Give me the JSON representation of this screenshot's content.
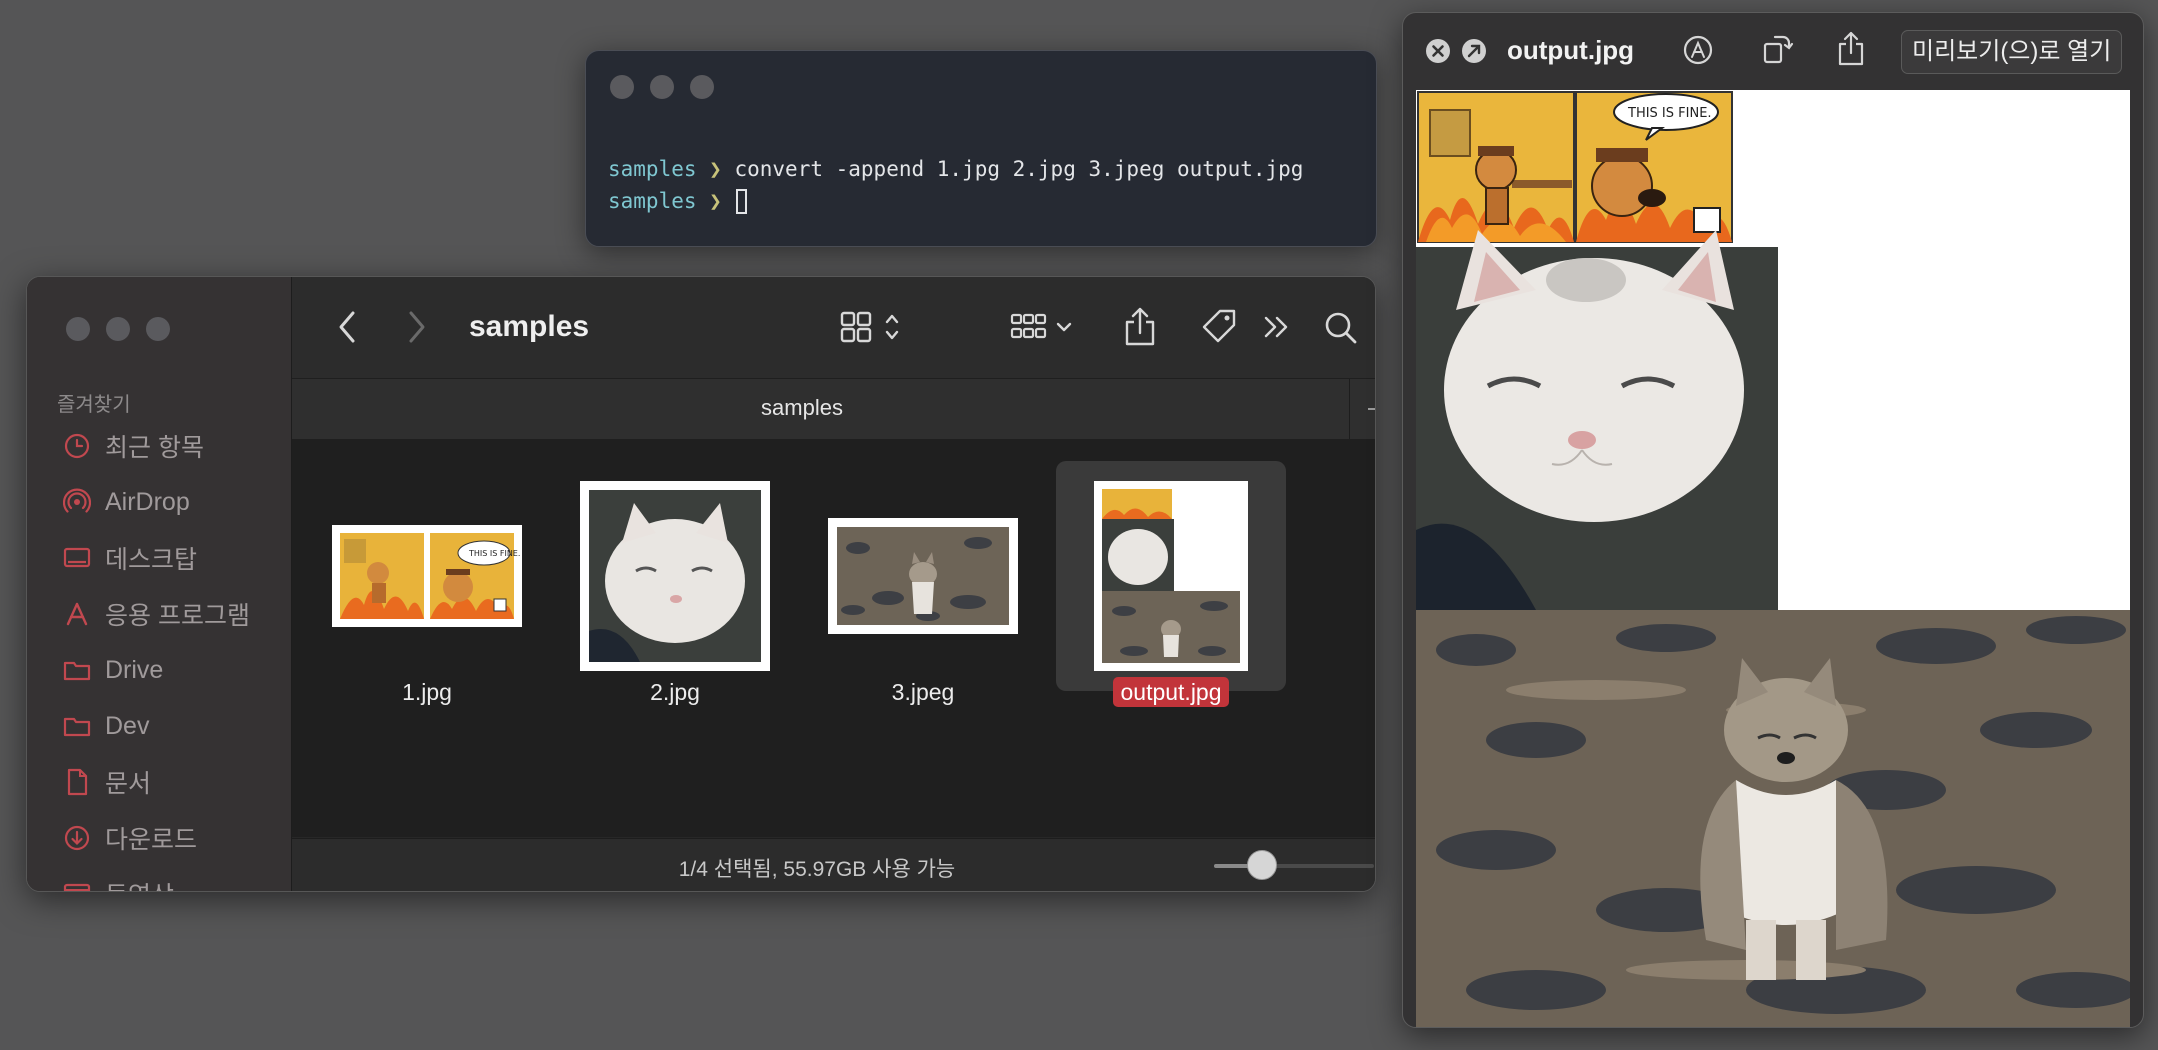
{
  "terminal": {
    "lines": [
      {
        "dir": "samples",
        "arrow": "❯",
        "command": "convert -append 1.jpg 2.jpg 3.jpeg output.jpg"
      },
      {
        "dir": "samples",
        "arrow": "❯",
        "command": ""
      }
    ]
  },
  "finder": {
    "title": "samples",
    "tab_label": "samples",
    "sidebar": {
      "header": "즐겨찾기",
      "items": [
        {
          "label": "최근 항목",
          "icon": "clock-icon"
        },
        {
          "label": "AirDrop",
          "icon": "airdrop-icon"
        },
        {
          "label": "데스크탑",
          "icon": "desktop-icon"
        },
        {
          "label": "응용 프로그램",
          "icon": "applications-icon"
        },
        {
          "label": "Drive",
          "icon": "folder-icon"
        },
        {
          "label": "Dev",
          "icon": "folder-icon"
        },
        {
          "label": "문서",
          "icon": "document-icon"
        },
        {
          "label": "다운로드",
          "icon": "download-icon"
        },
        {
          "label": "동영상",
          "icon": "movie-icon"
        }
      ]
    },
    "files": [
      {
        "name": "1.jpg",
        "selected": false
      },
      {
        "name": "2.jpg",
        "selected": false
      },
      {
        "name": "3.jpeg",
        "selected": false
      },
      {
        "name": "output.jpg",
        "selected": true
      }
    ],
    "status": "1/4 선택됨, 55.97GB 사용 가능",
    "zoom_level": 0.3
  },
  "preview": {
    "title": "output.jpg",
    "open_button": "미리보기(으)로 열기"
  },
  "colors": {
    "selection": "#c2343a",
    "prompt_dir": "#7fc7d1",
    "prompt_arrow": "#c7c27a",
    "desktop": "#555556"
  }
}
